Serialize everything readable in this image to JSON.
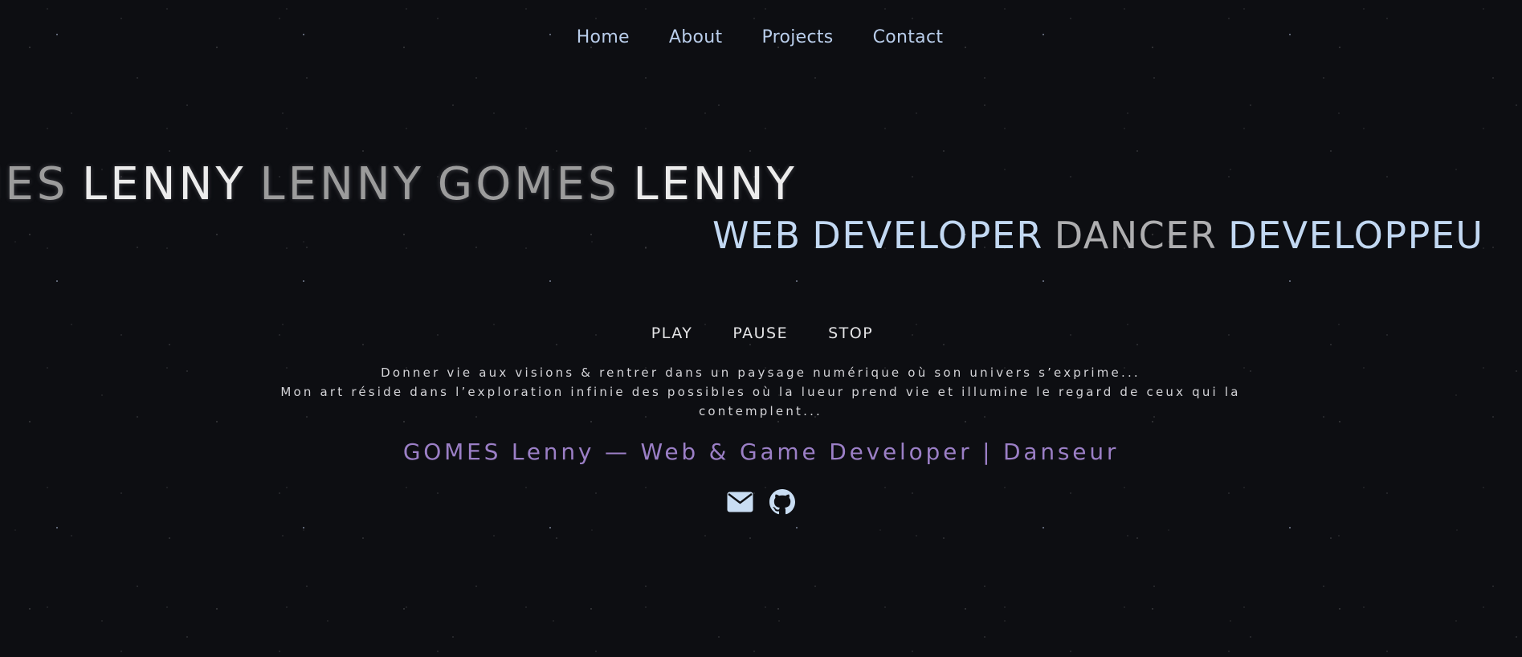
{
  "nav": {
    "items": [
      {
        "label": "Home"
      },
      {
        "label": "About"
      },
      {
        "label": "Projects"
      },
      {
        "label": "Contact"
      }
    ]
  },
  "marquee": {
    "name_words": [
      "MES",
      "LENNY",
      "LENNY",
      "GOMES",
      "LENNY"
    ],
    "role_words": [
      "WEB",
      "DEVELOPER",
      "DANCER",
      "DEVELOPPEU"
    ]
  },
  "audio": {
    "play_label": "PLAY",
    "pause_label": "PAUSE",
    "stop_label": "STOP"
  },
  "tagline": {
    "line1": "Donner vie aux visions & rentrer dans un paysage numérique où son univers s’exprime...",
    "line2": "Mon art réside dans l’exploration infinie des possibles où la lueur prend vie et illumine le regard de ceux qui la contemplent..."
  },
  "subtitle": "GOMES Lenny — Web & Game Developer | Danseur",
  "socials": {
    "icons": [
      "envelope-icon",
      "github-icon"
    ]
  },
  "colors": {
    "background": "#0d0e12",
    "nav_text": "#b9cdea",
    "accent_purple": "#9b7fc6",
    "role_blue": "#c2d8f2"
  }
}
